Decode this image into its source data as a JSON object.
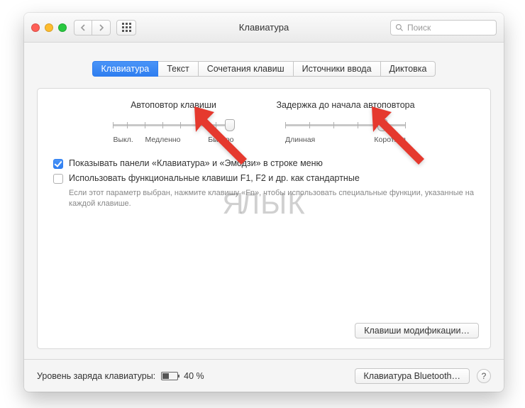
{
  "window": {
    "title": "Клавиатура"
  },
  "search": {
    "placeholder": "Поиск"
  },
  "tabs": [
    {
      "label": "Клавиатура",
      "active": true
    },
    {
      "label": "Текст",
      "active": false
    },
    {
      "label": "Сочетания клавиш",
      "active": false
    },
    {
      "label": "Источники ввода",
      "active": false
    },
    {
      "label": "Диктовка",
      "active": false
    }
  ],
  "sliders": {
    "repeat": {
      "label": "Автоповтор клавиши",
      "left": "Выкл.",
      "mid": "Медленно",
      "right": "Быстро",
      "value_pct": 100
    },
    "delay": {
      "label": "Задержка до начала автоповтора",
      "left": "Длинная",
      "right": "Короткая",
      "value_pct": 83
    }
  },
  "checks": {
    "show_panel": {
      "checked": true,
      "label": "Показывать панели «Клавиатура» и «Эмодзи» в строке меню"
    },
    "use_fn": {
      "checked": false,
      "label": "Использовать функциональные клавиши F1, F2 и др. как стандартные",
      "hint": "Если этот параметр выбран, нажмите клавишу «Fn», чтобы использовать специальные функции, указанные на каждой клавише."
    }
  },
  "buttons": {
    "modifier": "Клавиши модификации…",
    "bluetooth": "Клавиатура Bluetooth…"
  },
  "footer": {
    "battery_label": "Уровень заряда клавиатуры:",
    "battery_value": "40 %",
    "battery_pct": 40
  },
  "watermark": {
    "left": "Я",
    "right": "ЛЫК"
  },
  "help": "?"
}
